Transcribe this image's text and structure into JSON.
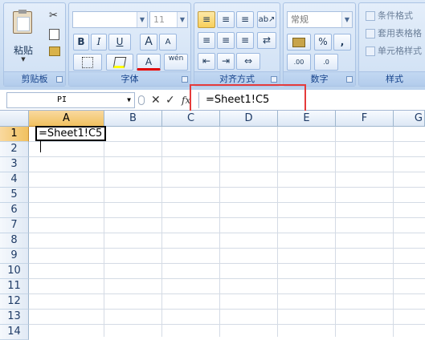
{
  "ribbon": {
    "clipboard": {
      "paste_label": "粘贴",
      "group_label": "剪贴板"
    },
    "font": {
      "font_name": "",
      "font_size": "11",
      "group_label": "字体",
      "bold": "B",
      "italic": "I",
      "underline": "U",
      "grow": "A",
      "shrink": "A",
      "font_color": "A",
      "wen": "wén"
    },
    "alignment": {
      "group_label": "对齐方式"
    },
    "number": {
      "format_value": "常规",
      "percent": "%",
      "comma": ",",
      "group_label": "数字"
    },
    "styles": {
      "conditional": "条件格式",
      "table": "套用表格格",
      "cell": "单元格样式",
      "group_label": "样式"
    }
  },
  "formula_bar": {
    "name_box": "PI",
    "formula": "=Sheet1!C5",
    "fx": "fx"
  },
  "sheet": {
    "columns": [
      "A",
      "B",
      "C",
      "D",
      "E",
      "F",
      "G"
    ],
    "rows": [
      "1",
      "2",
      "3",
      "4",
      "5",
      "6",
      "7",
      "8",
      "9",
      "10",
      "11",
      "12",
      "13",
      "14"
    ],
    "active_cell_value": "=Sheet1!C5",
    "colors": {
      "selected_header": "#f1c15f",
      "highlight_box": "#e53b3b"
    }
  }
}
